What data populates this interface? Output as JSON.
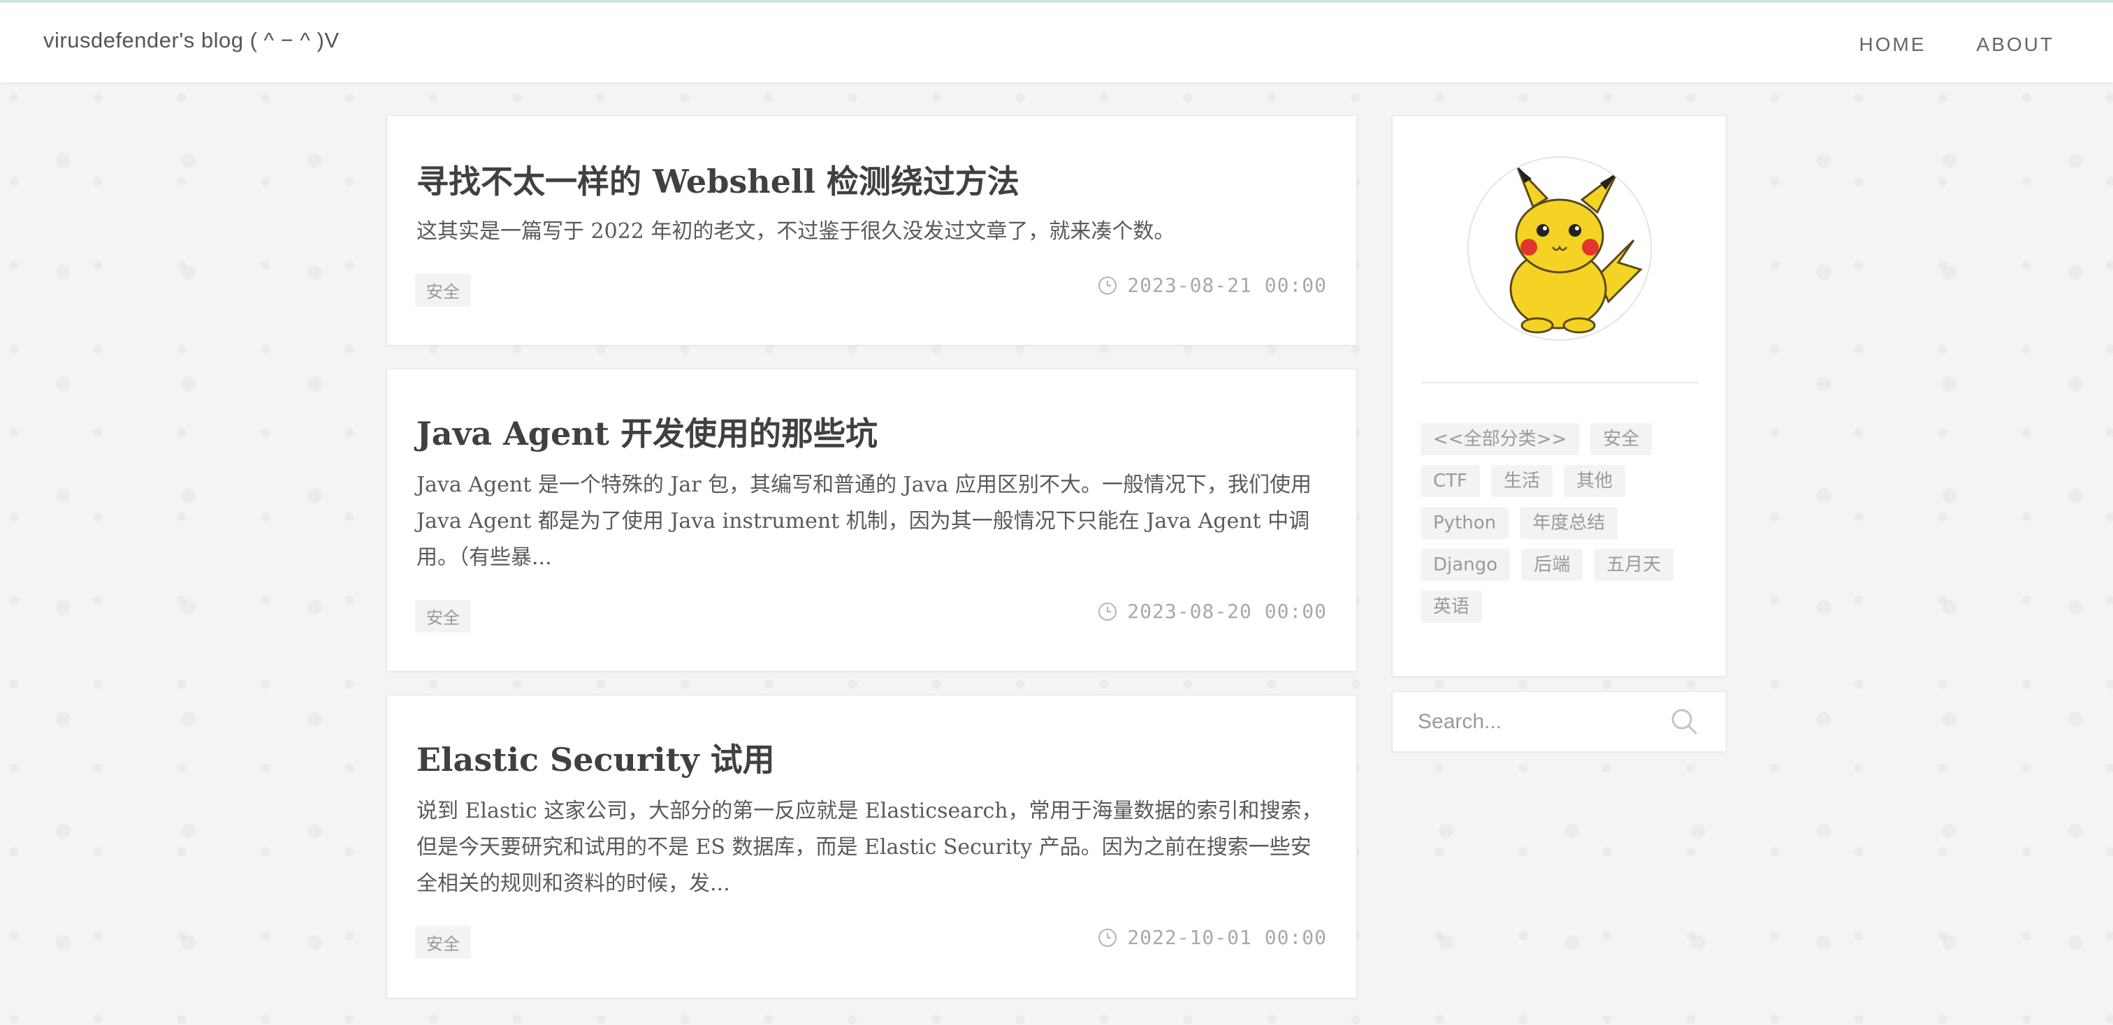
{
  "site": {
    "brand": "virusdefender's blog ( ^ − ^ )V"
  },
  "nav": {
    "items": [
      {
        "label": "HOME"
      },
      {
        "label": "ABOUT"
      }
    ]
  },
  "posts": [
    {
      "title": "寻找不太一样的 Webshell 检测绕过方法",
      "excerpt": "这其实是一篇写于 2022 年初的老文，不过鉴于很久没发过文章了，就来凑个数。",
      "tag": "安全",
      "date": "2023-08-21 00:00"
    },
    {
      "title": "Java Agent 开发使用的那些坑",
      "excerpt": "Java Agent 是一个特殊的 Jar 包，其编写和普通的 Java 应用区别不大。一般情况下，我们使用 Java Agent 都是为了使用 Java instrument 机制，因为其一般情况下只能在 Java Agent 中调用。（有些暴...",
      "tag": "安全",
      "date": "2023-08-20 00:00"
    },
    {
      "title": "Elastic Security 试用",
      "excerpt": "说到 Elastic 这家公司，大部分的第一反应就是 Elasticsearch，常用于海量数据的索引和搜索，但是今天要研究和试用的不是 ES 数据库，而是 Elastic Security 产品。因为之前在搜索一些安全相关的规则和资料的时候，发...",
      "tag": "安全",
      "date": "2022-10-01 00:00"
    }
  ],
  "sidebar": {
    "avatar_icon": "pikachu-avatar",
    "tags": [
      "<<全部分类>>",
      "安全",
      "CTF",
      "生活",
      "其他",
      "Python",
      "年度总结",
      "Django",
      "后端",
      "五月天",
      "英语"
    ]
  },
  "search": {
    "placeholder": "Search..."
  },
  "colors": {
    "accent_top_border": "#cfe6de",
    "tag_bg": "#f3f3f3",
    "avatar_yellow": "#f5d325"
  }
}
